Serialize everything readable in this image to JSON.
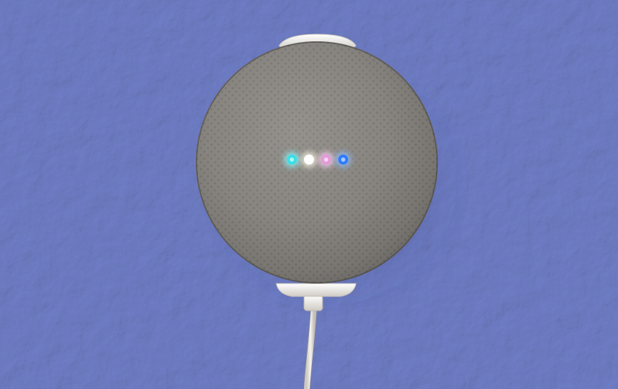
{
  "scene": {
    "subject": "smart-speaker",
    "mount": "wall-mount-bracket",
    "cable": "power-cable"
  },
  "colors": {
    "wall": "#8e9bd3",
    "wall_shadow": "#6f7cb8",
    "fabric": "#8a8782",
    "fabric_dark": "#5f5c58",
    "mount": "#e9e6e1",
    "cable": "#ece9e3"
  },
  "lights": [
    {
      "color": "#37e0e6",
      "glow": "#8ff7ff"
    },
    {
      "color": "#ffffff",
      "glow": "#fffbe8"
    },
    {
      "color": "#e39ad8",
      "glow": "#ffd1f6"
    },
    {
      "color": "#2f7bff",
      "glow": "#8fc0ff"
    }
  ]
}
